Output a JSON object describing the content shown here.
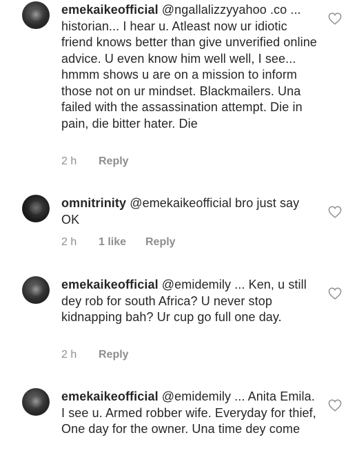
{
  "comments": [
    {
      "username": "emekaikeofficial",
      "text": " @ngallalizzyyahoo .co ... historian... I hear u. Atleast now ur idiotic friend knows better than give unverified online advice. U even know him well well, I see... hmmm shows u are on a mission to inform those not on ur mindset. Blackmailers. Una failed with the assassination attempt. Die in pain, die bitter hater. Die",
      "time": "2 h",
      "likes": "",
      "reply": "Reply",
      "avatar_icon": "user-avatar-icon"
    },
    {
      "username": "omnitrinity",
      "text": " @emekaikeofficial bro just say OK",
      "time": "2 h",
      "likes": "1 like",
      "reply": "Reply",
      "avatar_icon": "user-avatar-icon"
    },
    {
      "username": "emekaikeofficial",
      "text": " @emidemily ... Ken, u still dey rob for south Africa? U never stop kidnapping bah? Ur cup go full one day.",
      "time": "2 h",
      "likes": "",
      "reply": "Reply",
      "avatar_icon": "user-avatar-icon"
    },
    {
      "username": "emekaikeofficial",
      "text": " @emidemily ... Anita Emila. I see u. Armed robber wife. Everyday for thief, One day for the owner. Una time dey come",
      "time": "",
      "likes": "",
      "reply": "",
      "avatar_icon": "user-avatar-icon"
    }
  ],
  "colors": {
    "text": "#262626",
    "meta": "#8e8e8e",
    "heart": "#8e8e8e"
  },
  "icons": {
    "like": "heart-outline-icon"
  }
}
